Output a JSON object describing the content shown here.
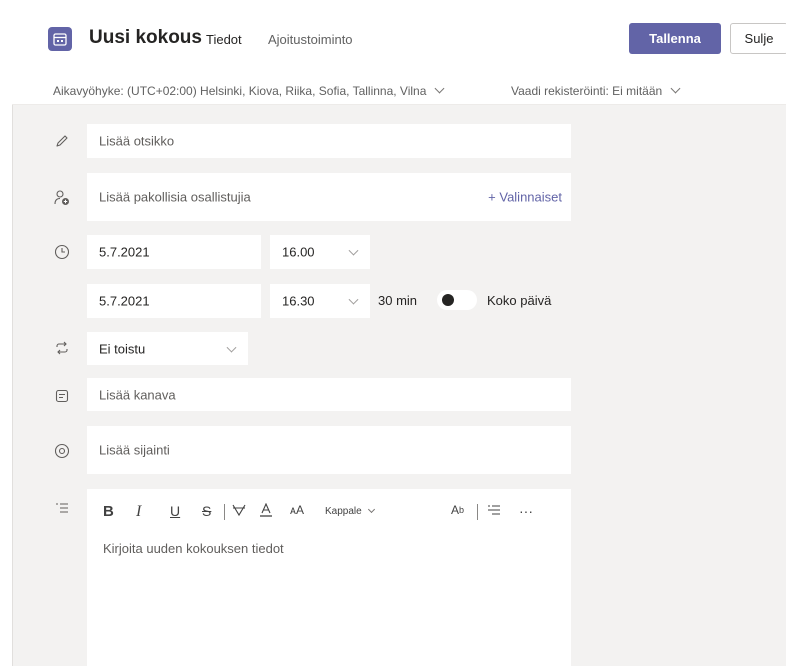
{
  "header": {
    "title": "Uusi kokous",
    "tabs": [
      {
        "label": "Tiedot",
        "active": true
      },
      {
        "label": "Ajoitustoiminto",
        "active": false
      }
    ],
    "save_label": "Tallenna",
    "close_label": "Sulje"
  },
  "timezone_bar": {
    "timezone": "Aikavyöhyke: (UTC+02:00) Helsinki, Kiova, Riika, Sofia, Tallinna, Vilna",
    "registration": "Vaadi rekisteröinti: Ei mitään"
  },
  "form": {
    "title_placeholder": "Lisää otsikko",
    "attendees_placeholder": "Lisää pakollisia osallistujia",
    "optional_label": "+ Valinnaiset",
    "start_date": "5.7.2021",
    "start_time": "16.00",
    "end_date": "5.7.2021",
    "end_time": "16.30",
    "duration": "30 min",
    "all_day_label": "Koko päivä",
    "all_day_on": false,
    "repeat": "Ei toistu",
    "channel_placeholder": "Lisää kanava",
    "location_placeholder": "Lisää sijainti",
    "editor": {
      "paragraph_label": "Kappale",
      "more_label": "···",
      "placeholder": "Kirjoita uuden kokouksen tiedot"
    }
  },
  "icons": {
    "app": "calendar-icon",
    "title_row": "pencil-icon",
    "attendees_row": "add-person-icon",
    "time_row": "clock-icon",
    "repeat_row": "repeat-icon",
    "channel_row": "channel-icon",
    "location_row": "location-pin-icon",
    "details_row": "text-details-icon"
  },
  "colors": {
    "accent": "#6264a7",
    "background": "#f3f2f1"
  }
}
